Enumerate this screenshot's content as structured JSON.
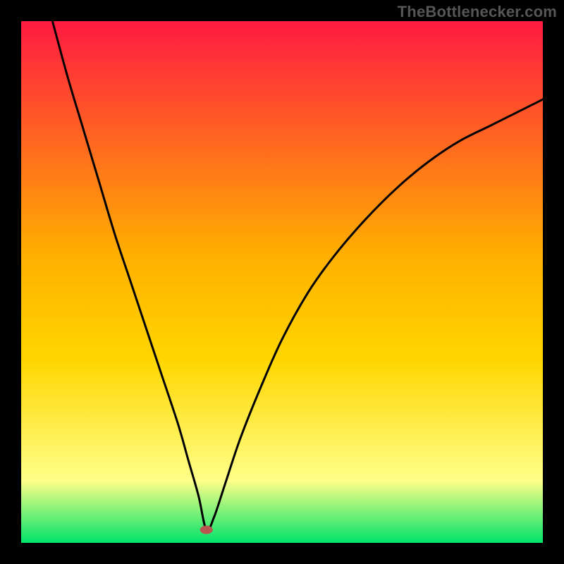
{
  "watermark": "TheBottlenecker.com",
  "chart_data": {
    "type": "line",
    "title": "",
    "xlabel": "",
    "ylabel": "",
    "xlim": [
      0,
      100
    ],
    "ylim": [
      0,
      100
    ],
    "grid": false,
    "legend": false,
    "gradient_colors": {
      "top": "#ff1a42",
      "mid": "#ffd600",
      "low": "#ffff88",
      "bottom": "#00e36a"
    },
    "marker": {
      "x": 35.5,
      "y": 2.5,
      "color": "#b9564f"
    },
    "series": [
      {
        "name": "curve",
        "x": [
          6,
          9,
          12,
          15,
          18,
          21,
          24,
          27,
          30,
          32,
          34,
          35.5,
          37,
          39,
          42,
          46,
          50,
          55,
          60,
          66,
          72,
          78,
          84,
          90,
          96,
          100
        ],
        "y": [
          100,
          89,
          79,
          69,
          59,
          50,
          41,
          32,
          23,
          16,
          9,
          2.5,
          5,
          11,
          20,
          30,
          39,
          48,
          55,
          62,
          68,
          73,
          77,
          80,
          83,
          85
        ]
      }
    ]
  }
}
